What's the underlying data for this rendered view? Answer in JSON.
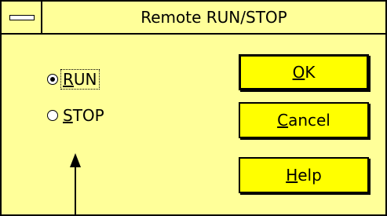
{
  "window": {
    "title": "Remote RUN/STOP"
  },
  "mode": {
    "options": [
      {
        "label_key": "R",
        "label_rest": "UN",
        "selected": true
      },
      {
        "label_key": "S",
        "label_rest": "TOP",
        "selected": false
      }
    ]
  },
  "buttons": {
    "ok": {
      "key": "O",
      "rest": "K"
    },
    "cancel": {
      "key": "C",
      "rest": "ancel"
    },
    "help": {
      "key": "H",
      "rest": "elp"
    }
  },
  "colors": {
    "dialog_bg": "#ffff99",
    "button_bg": "#ffff00"
  }
}
